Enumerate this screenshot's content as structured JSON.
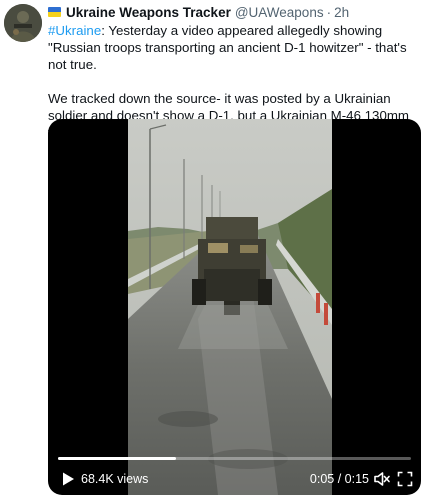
{
  "tweet": {
    "author_name": "Ukraine Weapons Tracker",
    "author_handle": "@UAWeapons",
    "separator": "·",
    "time": "2h",
    "hashtag": "#Ukraine",
    "line1_rest": ": Yesterday a video appeared allegedly showing \"Russian troops transporting an ancient D-1 howitzer\" - that's not true.",
    "paragraph2": "We tracked down the source- it was posted by a Ukrainian soldier and doesn't show a D-1, but a Ukrainian M-46 130mm field gun, donated by Croatia."
  },
  "video": {
    "views": "68.4K views",
    "timecode": "0:05 / 0:15",
    "progress": 0.333
  },
  "icons": {
    "flag": "ukraine-flag-icon",
    "play": "play-icon",
    "mute": "mute-icon",
    "fullscreen": "fullscreen-icon"
  },
  "colors": {
    "link": "#1d9bf0",
    "muted": "#536471",
    "flag_blue": "#2f6fd1",
    "flag_yellow": "#f5d11c"
  }
}
